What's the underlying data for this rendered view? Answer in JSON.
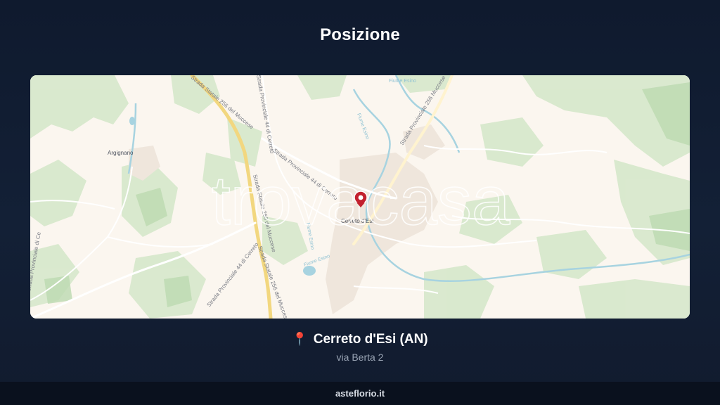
{
  "header": {
    "title": "Posizione"
  },
  "map": {
    "watermark": "trovacasa",
    "place_labels": {
      "argignano": "Argignano",
      "cerreto": "Cerreto d'Esi"
    },
    "road_labels": {
      "ss256_top": "Strada Statale 256 del Muccese",
      "sp44_top": "Strada Provinciale 44 di Cerreto",
      "sp44_mid": "Strada Provinciale 44 di Cerreto",
      "sp256": "Strada Provinciale 256 Muccese",
      "ss256_mid": "Strada Statale 256 del Muccese",
      "ss256_bottom": "Strada Statale 256 del Muccese",
      "sp44_bottom": "Strada Provinciale 44 di Cerreto",
      "sp_left": "Strada Provinciale di Ce"
    },
    "water_labels": {
      "esino_top": "Fiume Esino",
      "esino_mid": "Fiume Esino",
      "esino_left": "Fiume Esino",
      "esino_low": "Fiume Esino"
    },
    "marker_icon": "location-marker-icon",
    "colors": {
      "marker": "#c2212e",
      "road_major": "#f2d77f",
      "green": "#cfe4c4"
    }
  },
  "location": {
    "pin_icon": "📍",
    "city": "Cerreto d'Esi (AN)",
    "address": "via Berta 2"
  },
  "footer": {
    "site": "asteflorio.it"
  }
}
